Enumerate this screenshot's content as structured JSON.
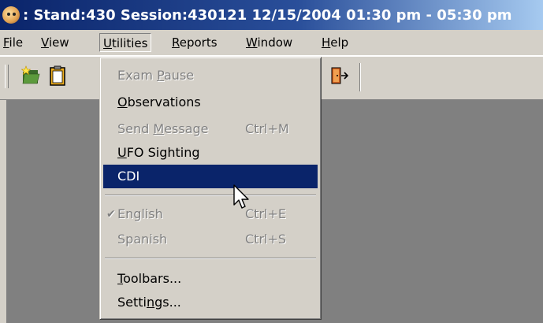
{
  "window": {
    "title": ": Stand:430 Session:430121 12/15/2004 01:30 pm - 05:30 pm"
  },
  "menubar": {
    "items": [
      {
        "label": "File",
        "mnemonic": "F",
        "rest": "ile"
      },
      {
        "label": "View",
        "mnemonic": "V",
        "rest": "iew"
      },
      {
        "label": "Utilities",
        "mnemonic": "U",
        "rest": "tilities"
      },
      {
        "label": "Reports",
        "mnemonic": "R",
        "rest": "eports"
      },
      {
        "label": "Window",
        "mnemonic": "W",
        "rest": "indow"
      },
      {
        "label": "Help",
        "mnemonic": "H",
        "rest": "elp"
      }
    ],
    "active": "Utilities"
  },
  "toolbar": {
    "buttons": [
      "new-folder-icon",
      "clipboard-icon",
      "exit-door-icon"
    ]
  },
  "utilities_menu": {
    "items": [
      {
        "pre": "Exam ",
        "mn": "P",
        "post": "ause",
        "shortcut": "",
        "state": "disabled"
      },
      {
        "pre": "",
        "mn": "O",
        "post": "bservations",
        "shortcut": "",
        "state": "enabled"
      },
      {
        "pre": "Send ",
        "mn": "M",
        "post": "essage",
        "shortcut": "Ctrl+M",
        "state": "disabled"
      },
      {
        "pre": "",
        "mn": "U",
        "post": "FO Sighting",
        "shortcut": "",
        "state": "enabled"
      },
      {
        "pre": "CDI",
        "mn": "",
        "post": "",
        "shortcut": "",
        "state": "highlighted"
      },
      {
        "pre": "English",
        "mn": "",
        "post": "",
        "shortcut": "Ctrl+E",
        "state": "disabled-checked"
      },
      {
        "pre": "Spanish",
        "mn": "",
        "post": "",
        "shortcut": "Ctrl+S",
        "state": "disabled"
      },
      {
        "pre": "",
        "mn": "T",
        "post": "oolbars...",
        "shortcut": "",
        "state": "enabled"
      },
      {
        "pre": "Setti",
        "mn": "n",
        "post": "gs...",
        "shortcut": "",
        "state": "enabled"
      }
    ]
  },
  "colors": {
    "title_start": "#0a246a",
    "title_end": "#a6caf0",
    "menu_bg": "#d4d0c8",
    "highlight": "#0a246a",
    "workspace": "#808080"
  }
}
